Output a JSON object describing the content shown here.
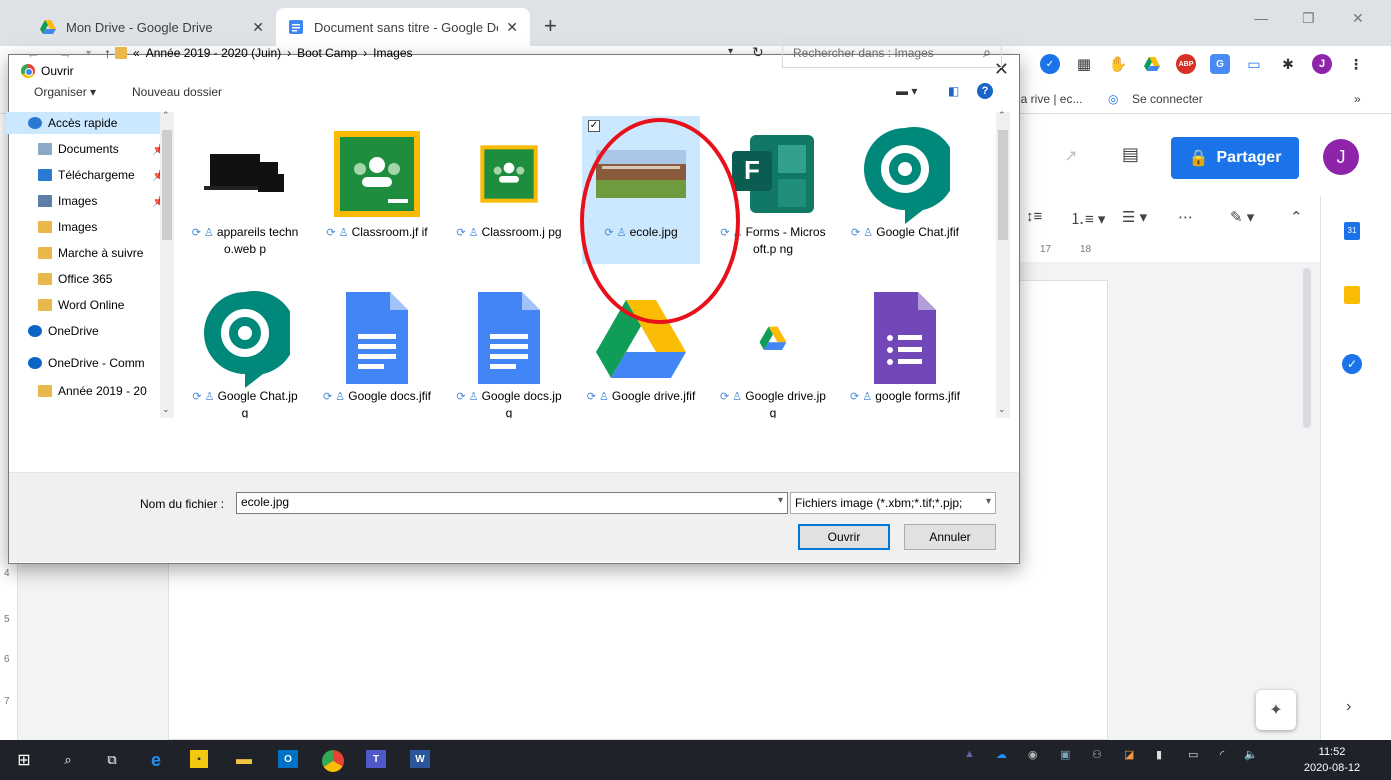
{
  "browser": {
    "tabs": [
      {
        "title": "Mon Drive - Google Drive"
      },
      {
        "title": "Document sans titre - Google Do"
      }
    ],
    "bookmarks": {
      "item1": "la rive | ec...",
      "item2": "Se connecter"
    },
    "extensions_more": "»",
    "profile_initial": "J"
  },
  "docs": {
    "share_label": "Partager",
    "avatar_initial": "J",
    "ruler_labels": [
      "17",
      "18"
    ],
    "vruler_labels": [
      "4",
      "5",
      "6",
      "7"
    ]
  },
  "dialog": {
    "title": "Ouvrir",
    "breadcrumb": {
      "prefix": "«",
      "parts": [
        "Année 2019 - 2020 (Juin)",
        "Boot Camp",
        "Images"
      ]
    },
    "search_placeholder": "Rechercher dans : Images",
    "cmd": {
      "organize": "Organiser ▾",
      "new_folder": "Nouveau dossier"
    },
    "nav": [
      {
        "label": "Accès rapide",
        "icon": "star-icon",
        "color": "#2a7ad2",
        "pinned": false,
        "selected": true
      },
      {
        "label": "Documents",
        "icon": "documents-icon",
        "color": "#8aa9c7",
        "pinned": true,
        "selected": false
      },
      {
        "label": "Téléchargeme",
        "icon": "download-icon",
        "color": "#2a7ad2",
        "pinned": true,
        "selected": false
      },
      {
        "label": "Images",
        "icon": "images-icon",
        "color": "#5b7fa6",
        "pinned": true,
        "selected": false
      },
      {
        "label": "Images",
        "icon": "folder-icon",
        "color": "#e8b84a",
        "pinned": false,
        "selected": false
      },
      {
        "label": "Marche à suivre",
        "icon": "folder-icon",
        "color": "#e8b84a",
        "pinned": false,
        "selected": false
      },
      {
        "label": "Office 365",
        "icon": "folder-icon",
        "color": "#e8b84a",
        "pinned": false,
        "selected": false
      },
      {
        "label": "Word Online",
        "icon": "folder-icon",
        "color": "#e8b84a",
        "pinned": false,
        "selected": false
      },
      {
        "label": "OneDrive",
        "icon": "onedrive-icon",
        "color": "#0a64c8",
        "pinned": false,
        "selected": false
      },
      {
        "label": "OneDrive - Comm",
        "icon": "onedrive-icon",
        "color": "#0a64c8",
        "pinned": false,
        "selected": false
      },
      {
        "label": "Année 2019 - 20",
        "icon": "folder-icon",
        "color": "#e8b84a",
        "pinned": false,
        "selected": false
      }
    ],
    "files": [
      {
        "name": "appareils techno.web p",
        "kind": "devices",
        "selected": false
      },
      {
        "name": "Classroom.jf if",
        "kind": "classroom",
        "selected": false
      },
      {
        "name": "Classroom.j pg",
        "kind": "classroom-small",
        "selected": false
      },
      {
        "name": "ecole.jpg",
        "kind": "photo",
        "selected": true
      },
      {
        "name": "Forms - Microsoft.p ng",
        "kind": "msforms",
        "selected": false
      },
      {
        "name": "Google Chat.jfif",
        "kind": "gchat",
        "selected": false
      },
      {
        "name": "Google Chat.jpg",
        "kind": "gchat",
        "selected": false
      },
      {
        "name": "Google docs.jfif",
        "kind": "gdocs",
        "selected": false
      },
      {
        "name": "Google docs.jpg",
        "kind": "gdocs",
        "selected": false
      },
      {
        "name": "Google drive.jfif",
        "kind": "gdrive",
        "selected": false
      },
      {
        "name": "Google drive.jpg",
        "kind": "gdrive-small",
        "selected": false
      },
      {
        "name": "google forms.jfif",
        "kind": "gforms",
        "selected": false
      }
    ],
    "file_name_label": "Nom du fichier :",
    "file_name_value": "ecole.jpg",
    "filter_value": "Fichiers image (*.xbm;*.tif;*.pjp;",
    "open_label": "Ouvrir",
    "cancel_label": "Annuler"
  },
  "taskbar": {
    "time": "11:52",
    "date": "2020-08-12"
  }
}
